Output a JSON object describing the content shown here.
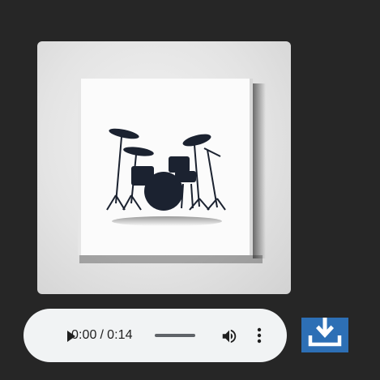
{
  "album_art": {
    "icon": "drum-kit-artwork"
  },
  "audio_player": {
    "current_time": "0:00",
    "separator": "/",
    "duration": "0:14",
    "progress": 0,
    "play_icon": "play-icon",
    "volume_icon": "volume-icon",
    "menu_icon": "more-vert-icon"
  },
  "download": {
    "icon": "download-icon",
    "color": "#2d6fb5"
  },
  "colors": {
    "background": "#262626",
    "player_background": "#f1f3f4"
  }
}
